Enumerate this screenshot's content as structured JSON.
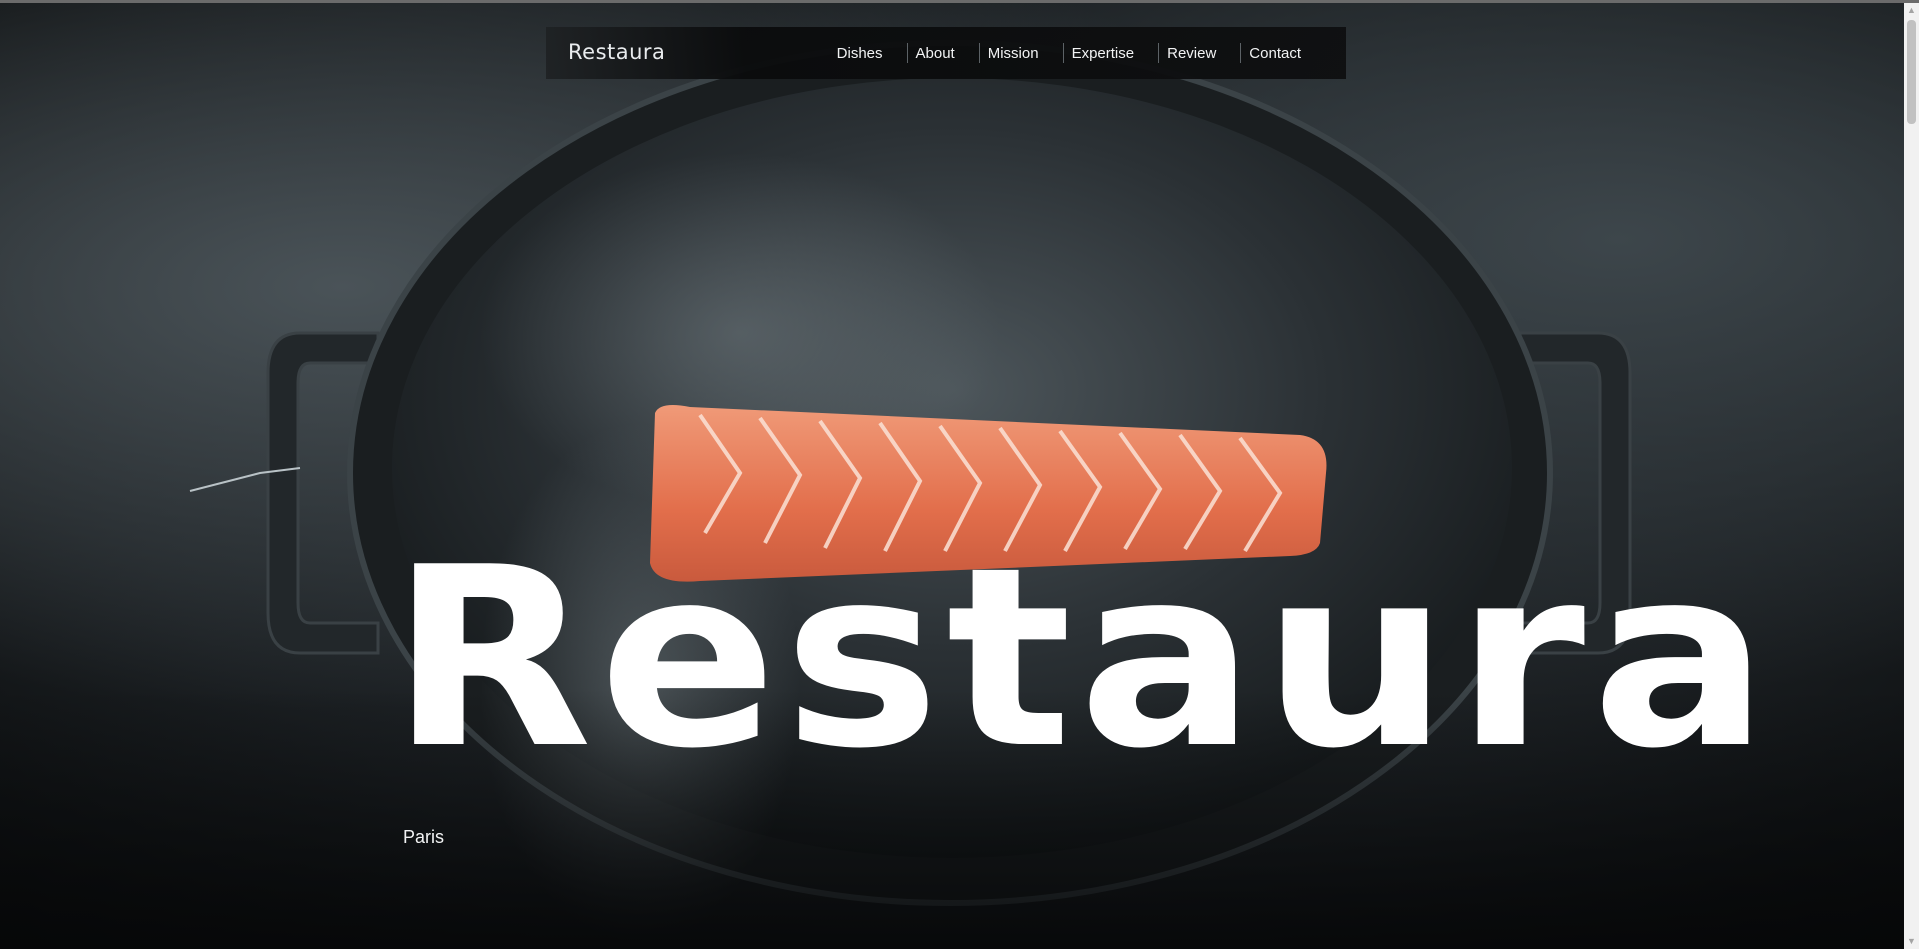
{
  "navbar": {
    "logo": "Restaura",
    "links": [
      {
        "label": "Dishes"
      },
      {
        "label": "About"
      },
      {
        "label": "Mission"
      },
      {
        "label": "Expertise"
      },
      {
        "label": "Review"
      },
      {
        "label": "Contact"
      }
    ]
  },
  "hero": {
    "title": "Restaura",
    "city": "Paris",
    "image_subject": "salmon-fillet-in-pan"
  },
  "scrollbar": {
    "up_icon": "triangle-up-icon",
    "down_icon": "triangle-down-icon",
    "up_glyph": "▲",
    "down_glyph": "▼"
  },
  "colors": {
    "background": "#0b0d0e",
    "text": "#ffffff",
    "salmon": "#e57a57"
  }
}
